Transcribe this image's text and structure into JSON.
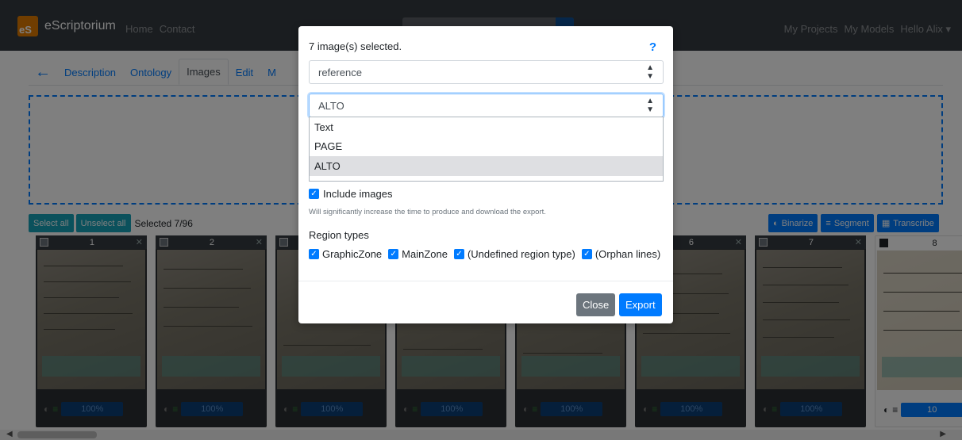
{
  "navbar": {
    "brand": "eScriptorium",
    "logo_text": "eS",
    "links": [
      "Home",
      "Contact"
    ],
    "right_links": [
      "My Projects",
      "My Models",
      "Hello Alix ▾"
    ]
  },
  "tabs": [
    "Description",
    "Ontology",
    "Images",
    "Edit",
    "M"
  ],
  "toolbar": {
    "select_all": "Select all",
    "unselect_all": "Unselect all",
    "selected": "Selected 7/96",
    "binarize": "Binarize",
    "segment": "Segment",
    "transcribe": "Transcribe"
  },
  "thumbnails": [
    {
      "num": "1",
      "progress": "100%"
    },
    {
      "num": "2",
      "progress": "100%"
    },
    {
      "num": "3",
      "progress": "100%"
    },
    {
      "num": "4",
      "progress": "100%"
    },
    {
      "num": "5",
      "progress": "100%"
    },
    {
      "num": "6",
      "progress": "100%"
    },
    {
      "num": "7",
      "progress": "100%"
    },
    {
      "num": "8",
      "progress": "10"
    }
  ],
  "modal": {
    "title": "7 image(s) selected.",
    "help": "?",
    "transcription_select": "reference",
    "format_select": "ALTO",
    "format_options": [
      "Text",
      "PAGE",
      "ALTO"
    ],
    "include_images_label": "Include images",
    "include_images_hint": "Will significantly increase the time to produce and download the export.",
    "region_types_label": "Region types",
    "region_types": [
      "GraphicZone",
      "MainZone",
      "(Undefined region type)",
      "(Orphan lines)"
    ],
    "close_label": "Close",
    "export_label": "Export"
  },
  "colors": {
    "primary": "#007bff",
    "navbar": "#343a40",
    "info": "#17a2b8",
    "secondary": "#6c757d"
  }
}
